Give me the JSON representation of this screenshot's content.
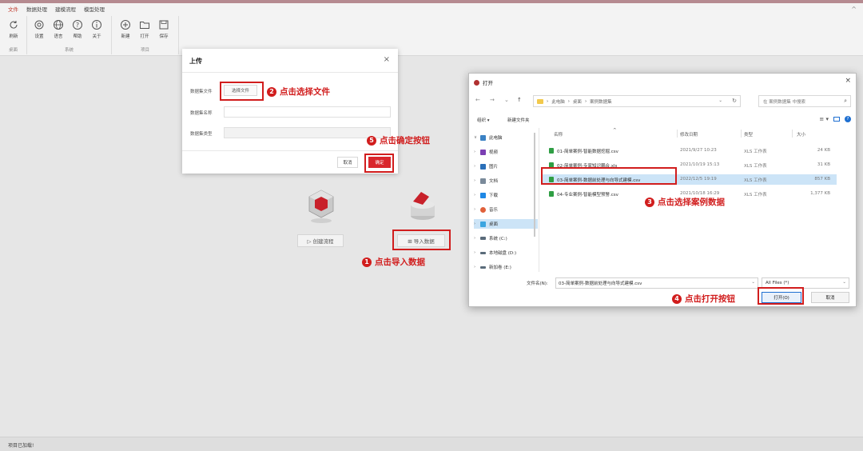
{
  "menu": {
    "items": [
      "文件",
      "数据处理",
      "建模流程",
      "模型处理"
    ],
    "collapse": "^"
  },
  "ribbon": {
    "groups": [
      {
        "label": "桌面",
        "buttons": [
          "刷新"
        ]
      },
      {
        "label": "系统",
        "buttons": [
          "设置",
          "语言",
          "帮助",
          "关于"
        ]
      },
      {
        "label": "项目",
        "buttons": [
          "新建",
          "打开",
          "保存"
        ]
      }
    ]
  },
  "center": {
    "create_flow": "▷ 创建流程",
    "import_data": "⊞ 导入数据"
  },
  "upload_dialog": {
    "title": "上传",
    "close": "×",
    "dataset_file_label": "数据集文件",
    "select_file_button": "选择文件",
    "dataset_name_label": "数据集名称",
    "dataset_type_label": "数据集类型",
    "cancel": "取消",
    "confirm": "确定"
  },
  "open_dialog": {
    "title": "打开",
    "close": "×",
    "nav": {
      "back": "←",
      "forward": "→",
      "recent": "⌄",
      "up": "↑"
    },
    "address": [
      "此电脑",
      "桌面",
      "案例数据集"
    ],
    "search_placeholder": "在 案例数据集 中搜索",
    "organize": "组织 ▾",
    "new_folder": "新建文件夹",
    "nav_items": [
      {
        "label": "此电脑",
        "chevron": "∨",
        "color": "#3b82c4"
      },
      {
        "label": "视频",
        "chevron": "›",
        "color": "#7b3fb3"
      },
      {
        "label": "图片",
        "chevron": "›",
        "color": "#2a6fb8"
      },
      {
        "label": "文档",
        "chevron": "›",
        "color": "#7a8a9a"
      },
      {
        "label": "下载",
        "chevron": "›",
        "color": "#1e88e5"
      },
      {
        "label": "音乐",
        "chevron": "›",
        "color": "#e0603a"
      },
      {
        "label": "桌面",
        "chevron": "›",
        "color": "#3ba5e0"
      },
      {
        "label": "系统 (C:)",
        "chevron": "›",
        "color": "#5a6b7a"
      },
      {
        "label": "本地磁盘 (D:)",
        "chevron": "›",
        "color": "#5a6b7a"
      },
      {
        "label": "新加卷 (E:)",
        "chevron": "›",
        "color": "#5a6b7a"
      }
    ],
    "columns": {
      "name": "名称",
      "modified": "修改日期",
      "type": "类型",
      "size": "大小",
      "sort": "^"
    },
    "files": [
      {
        "name": "01-简单案例-智能数据挖掘.csv",
        "modified": "2021/9/27 10:23",
        "type": "XLS 工作表",
        "size": "24 KB"
      },
      {
        "name": "02-简单案例-专家知识耦合.xls",
        "modified": "2021/10/19 15:13",
        "type": "XLS 工作表",
        "size": "31 KB"
      },
      {
        "name": "03-简单案例-数据前处理与向导式建模.csv",
        "modified": "2022/12/5 19:19",
        "type": "XLS 工作表",
        "size": "857 KB"
      },
      {
        "name": "04-专业案例-智能模型预警.csv",
        "modified": "2021/10/18 16:29",
        "type": "XLS 工作表",
        "size": "1,377 KB"
      }
    ],
    "selected_index": 2,
    "filename_label": "文件名(N):",
    "filename_value": "03-简单案例-数据前处理与向导式建模.csv",
    "filetype": "All Files (*)",
    "open": "打开(O)",
    "cancel": "取消"
  },
  "annotations": {
    "step1": {
      "num": "1",
      "text": "点击导入数据"
    },
    "step2": {
      "num": "2",
      "text": "点击选择文件"
    },
    "step3": {
      "num": "3",
      "text": "点击选择案例数据"
    },
    "step4": {
      "num": "4",
      "text": "点击打开按钮"
    },
    "step5": {
      "num": "5",
      "text": "点击确定按钮"
    }
  },
  "status": "项目已加载!",
  "colors": {
    "accent": "#d9262c",
    "annotation": "#d11d1d",
    "selection": "#cce4f7"
  }
}
